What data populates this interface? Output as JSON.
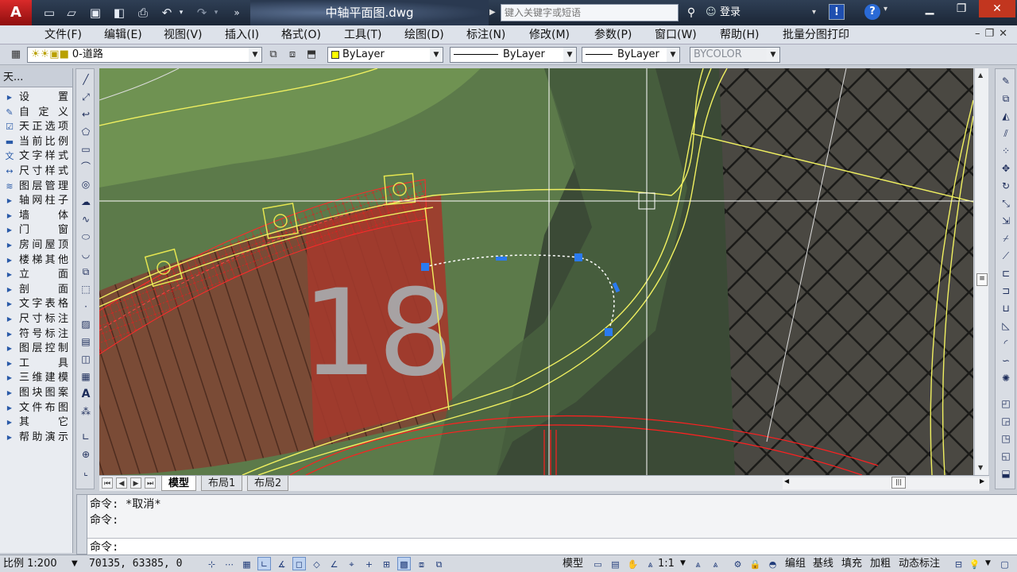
{
  "titlebar": {
    "logo": "A",
    "document_title": "中轴平面图.dwg",
    "search_placeholder": "键入关键字或短语",
    "login_label": "登录",
    "alert_label": "!",
    "help_label": "?"
  },
  "menu": {
    "items": [
      "文件(F)",
      "编辑(E)",
      "视图(V)",
      "插入(I)",
      "格式(O)",
      "工具(T)",
      "绘图(D)",
      "标注(N)",
      "修改(M)",
      "参数(P)",
      "窗口(W)",
      "帮助(H)",
      "批量分图打印"
    ]
  },
  "properties": {
    "layer": "0-道路",
    "color": "ByLayer",
    "linetype": "ByLayer",
    "lineweight": "ByLayer",
    "plotstyle": "BYCOLOR"
  },
  "sidepanel": {
    "title": "天...",
    "items": [
      {
        "label": "设　置",
        "icon": "triangle-icon",
        "kind": "group"
      },
      {
        "label": "自 定 义",
        "icon": "customize-icon",
        "kind": "sub"
      },
      {
        "label": "天正选项",
        "icon": "options-icon",
        "kind": "sub"
      },
      {
        "label": "当前比例",
        "icon": "scale-icon",
        "kind": "sub"
      },
      {
        "label": "文字样式",
        "icon": "text-style-icon",
        "kind": "sub"
      },
      {
        "label": "尺寸样式",
        "icon": "dim-style-icon",
        "kind": "sub"
      },
      {
        "label": "图层管理",
        "icon": "layers-icon",
        "kind": "sub"
      },
      {
        "label": "轴网柱子",
        "icon": "triangle-icon",
        "kind": "group"
      },
      {
        "label": "墙　体",
        "icon": "triangle-icon",
        "kind": "group"
      },
      {
        "label": "门　窗",
        "icon": "triangle-icon",
        "kind": "group"
      },
      {
        "label": "房间屋顶",
        "icon": "triangle-icon",
        "kind": "group"
      },
      {
        "label": "楼梯其他",
        "icon": "triangle-icon",
        "kind": "group"
      },
      {
        "label": "立　面",
        "icon": "triangle-icon",
        "kind": "group"
      },
      {
        "label": "剖　面",
        "icon": "triangle-icon",
        "kind": "group"
      },
      {
        "label": "文字表格",
        "icon": "triangle-icon",
        "kind": "group"
      },
      {
        "label": "尺寸标注",
        "icon": "triangle-icon",
        "kind": "group"
      },
      {
        "label": "符号标注",
        "icon": "triangle-icon",
        "kind": "group"
      },
      {
        "label": "图层控制",
        "icon": "triangle-icon",
        "kind": "group"
      },
      {
        "label": "工　具",
        "icon": "triangle-icon",
        "kind": "group"
      },
      {
        "label": "三维建模",
        "icon": "triangle-icon",
        "kind": "group"
      },
      {
        "label": "图块图案",
        "icon": "triangle-icon",
        "kind": "group"
      },
      {
        "label": "文件布图",
        "icon": "triangle-icon",
        "kind": "group"
      },
      {
        "label": "其　它",
        "icon": "triangle-icon",
        "kind": "group"
      },
      {
        "label": "帮助演示",
        "icon": "triangle-icon",
        "kind": "group"
      }
    ]
  },
  "drawing": {
    "overlay_number": "18"
  },
  "layout_tabs": [
    "模型",
    "布局1",
    "布局2"
  ],
  "command": {
    "history": [
      "命令: *取消*",
      "命令:"
    ],
    "prompt": "命令:",
    "value": ""
  },
  "status": {
    "scale": "比例 1:200",
    "coords": "70135, 63385, 0",
    "model": "模型",
    "annotation_scale": "1:1",
    "buttons": [
      "编组",
      "基线",
      "填充",
      "加粗",
      "动态标注"
    ]
  }
}
